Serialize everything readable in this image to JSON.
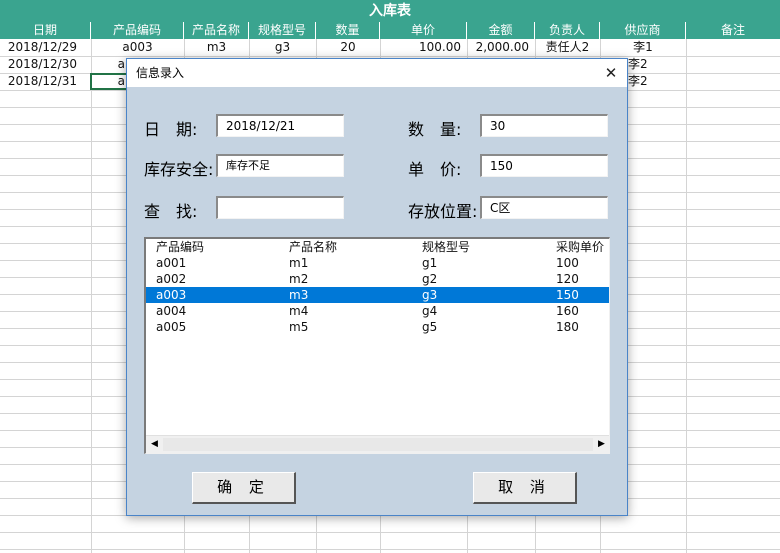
{
  "sheet": {
    "title": "入库表",
    "headers": [
      "日期",
      "产品编码",
      "产品名称",
      "规格型号",
      "数量",
      "单价",
      "金额",
      "负责人",
      "供应商",
      "备注"
    ],
    "rows": [
      [
        "2018/12/29",
        "a003",
        "m3",
        "g3",
        "20",
        "100.00",
        "2,000.00",
        "责任人2",
        "李1",
        ""
      ],
      [
        "2018/12/30",
        "a",
        "",
        "",
        "",
        "",
        "",
        "",
        "李2",
        ""
      ],
      [
        "2018/12/31",
        "a",
        "",
        "",
        "",
        "",
        "",
        "",
        "李2",
        ""
      ]
    ]
  },
  "dialog": {
    "title": "信息录入",
    "close_glyph": "✕",
    "labels": {
      "date": "日　期:",
      "stock": "库存安全:",
      "search": "查　找:",
      "qty": "数　量:",
      "price": "单　价:",
      "location": "存放位置:"
    },
    "fields": {
      "date": "2018/12/21",
      "stock": "库存不足",
      "search": "",
      "qty": "30",
      "price": "150",
      "location": "C区"
    },
    "list": {
      "headers": [
        "产品编码",
        "产品名称",
        "规格型号",
        "采购单价"
      ],
      "rows": [
        [
          "a001",
          "m1",
          "g1",
          "100"
        ],
        [
          "a002",
          "m2",
          "g2",
          "120"
        ],
        [
          "a003",
          "m3",
          "g3",
          "150"
        ],
        [
          "a004",
          "m4",
          "g4",
          "160"
        ],
        [
          "a005",
          "m5",
          "g5",
          "180"
        ]
      ],
      "selected_index": 2,
      "scroll_left_glyph": "◀",
      "scroll_right_glyph": "▶"
    },
    "buttons": {
      "ok": "确 定",
      "cancel": "取 消"
    }
  }
}
